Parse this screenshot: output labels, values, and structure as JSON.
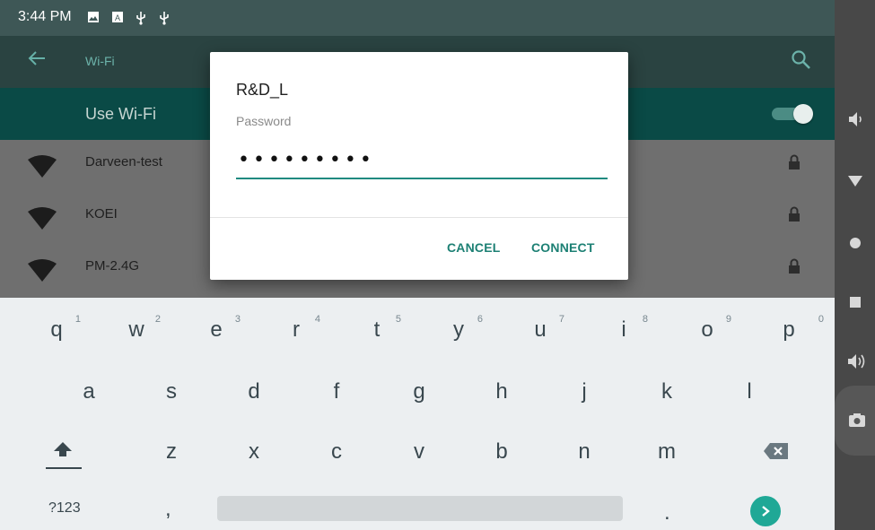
{
  "status_bar": {
    "time": "3:44 PM",
    "icons": [
      "image-icon",
      "a-box-icon",
      "usb-icon",
      "usb-icon"
    ]
  },
  "app_bar": {
    "title": "Wi-Fi",
    "icons": [
      "back-arrow-icon",
      "search-icon"
    ]
  },
  "use_wifi": {
    "label": "Use Wi-Fi",
    "enabled": true
  },
  "networks": [
    {
      "name": "Darveen-test",
      "secured": true
    },
    {
      "name": "KOEI",
      "secured": true
    },
    {
      "name": "PM-2.4G",
      "secured": true
    }
  ],
  "dialog": {
    "title": "R&D_L",
    "password_label": "Password",
    "password_value": "•••••••••",
    "cancel_label": "CANCEL",
    "connect_label": "CONNECT"
  },
  "keyboard": {
    "row1": [
      {
        "ch": "q",
        "hint": "1"
      },
      {
        "ch": "w",
        "hint": "2"
      },
      {
        "ch": "e",
        "hint": "3"
      },
      {
        "ch": "r",
        "hint": "4"
      },
      {
        "ch": "t",
        "hint": "5"
      },
      {
        "ch": "y",
        "hint": "6"
      },
      {
        "ch": "u",
        "hint": "7"
      },
      {
        "ch": "i",
        "hint": "8"
      },
      {
        "ch": "o",
        "hint": "9"
      },
      {
        "ch": "p",
        "hint": "0"
      }
    ],
    "row2": [
      "a",
      "s",
      "d",
      "f",
      "g",
      "h",
      "j",
      "k",
      "l"
    ],
    "row3": [
      "z",
      "x",
      "c",
      "v",
      "b",
      "n",
      "m"
    ],
    "symbols_label": "?123",
    "comma": ",",
    "period": ".",
    "icons": [
      "shift-icon",
      "backspace-icon",
      "go-arrow-icon"
    ]
  },
  "nav_bar": {
    "icons": [
      "volume-down-icon",
      "back-triangle-icon",
      "home-circle-icon",
      "recents-square-icon",
      "volume-up-icon",
      "camera-icon"
    ]
  },
  "colors": {
    "accent": "#1f8a80",
    "app_bar": "#2a4341",
    "status_bar": "#3e5756",
    "go_key": "#1fa896"
  }
}
